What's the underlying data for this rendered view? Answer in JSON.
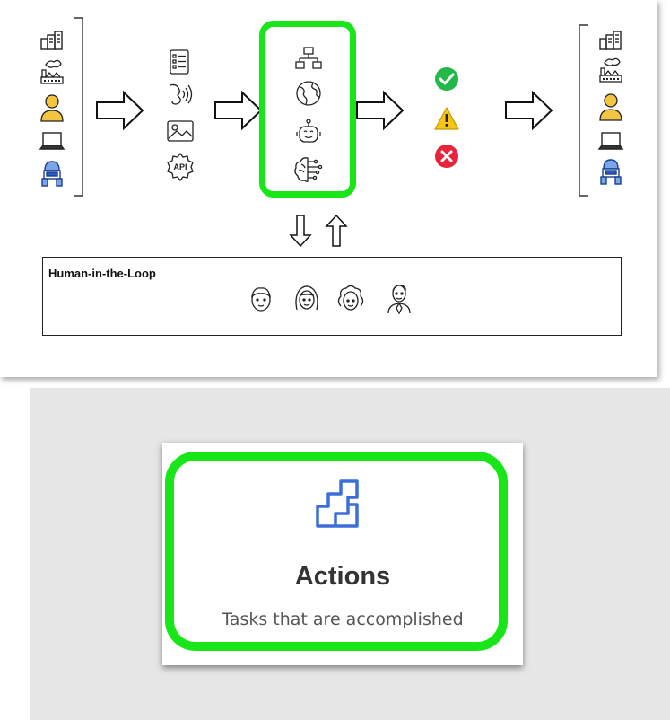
{
  "diagram": {
    "sources": {
      "icons": [
        "buildings-icon",
        "factory-icon",
        "person-icon",
        "laptop-icon",
        "robot-icon"
      ]
    },
    "inputs": {
      "icons": [
        "document-list-icon",
        "voice-icon",
        "image-icon",
        "api-gear-icon"
      ],
      "api_label": "API"
    },
    "ai_core": {
      "icons": [
        "network-icon",
        "globe-icon",
        "chatbot-icon",
        "brain-icon"
      ],
      "highlight_color": "#19e619"
    },
    "outcomes": {
      "icons": [
        "check-icon",
        "warning-icon",
        "error-icon"
      ],
      "colors": {
        "success": "#22b84a",
        "warning": "#f5c518",
        "error": "#e8243c"
      }
    },
    "targets": {
      "icons": [
        "buildings-icon",
        "factory-icon",
        "person-icon",
        "laptop-icon",
        "robot-icon"
      ]
    },
    "human_in_the_loop": {
      "title": "Human-in-the-Loop",
      "faces": [
        "man-face-icon",
        "woman-face-icon",
        "curly-woman-face-icon",
        "businessman-icon"
      ]
    }
  },
  "actions_card": {
    "title": "Actions",
    "subtitle": "Tasks that are accomplished",
    "icon": "actions-steps-icon",
    "icon_color": "#3b6fd8",
    "highlight_color": "#19e619"
  }
}
